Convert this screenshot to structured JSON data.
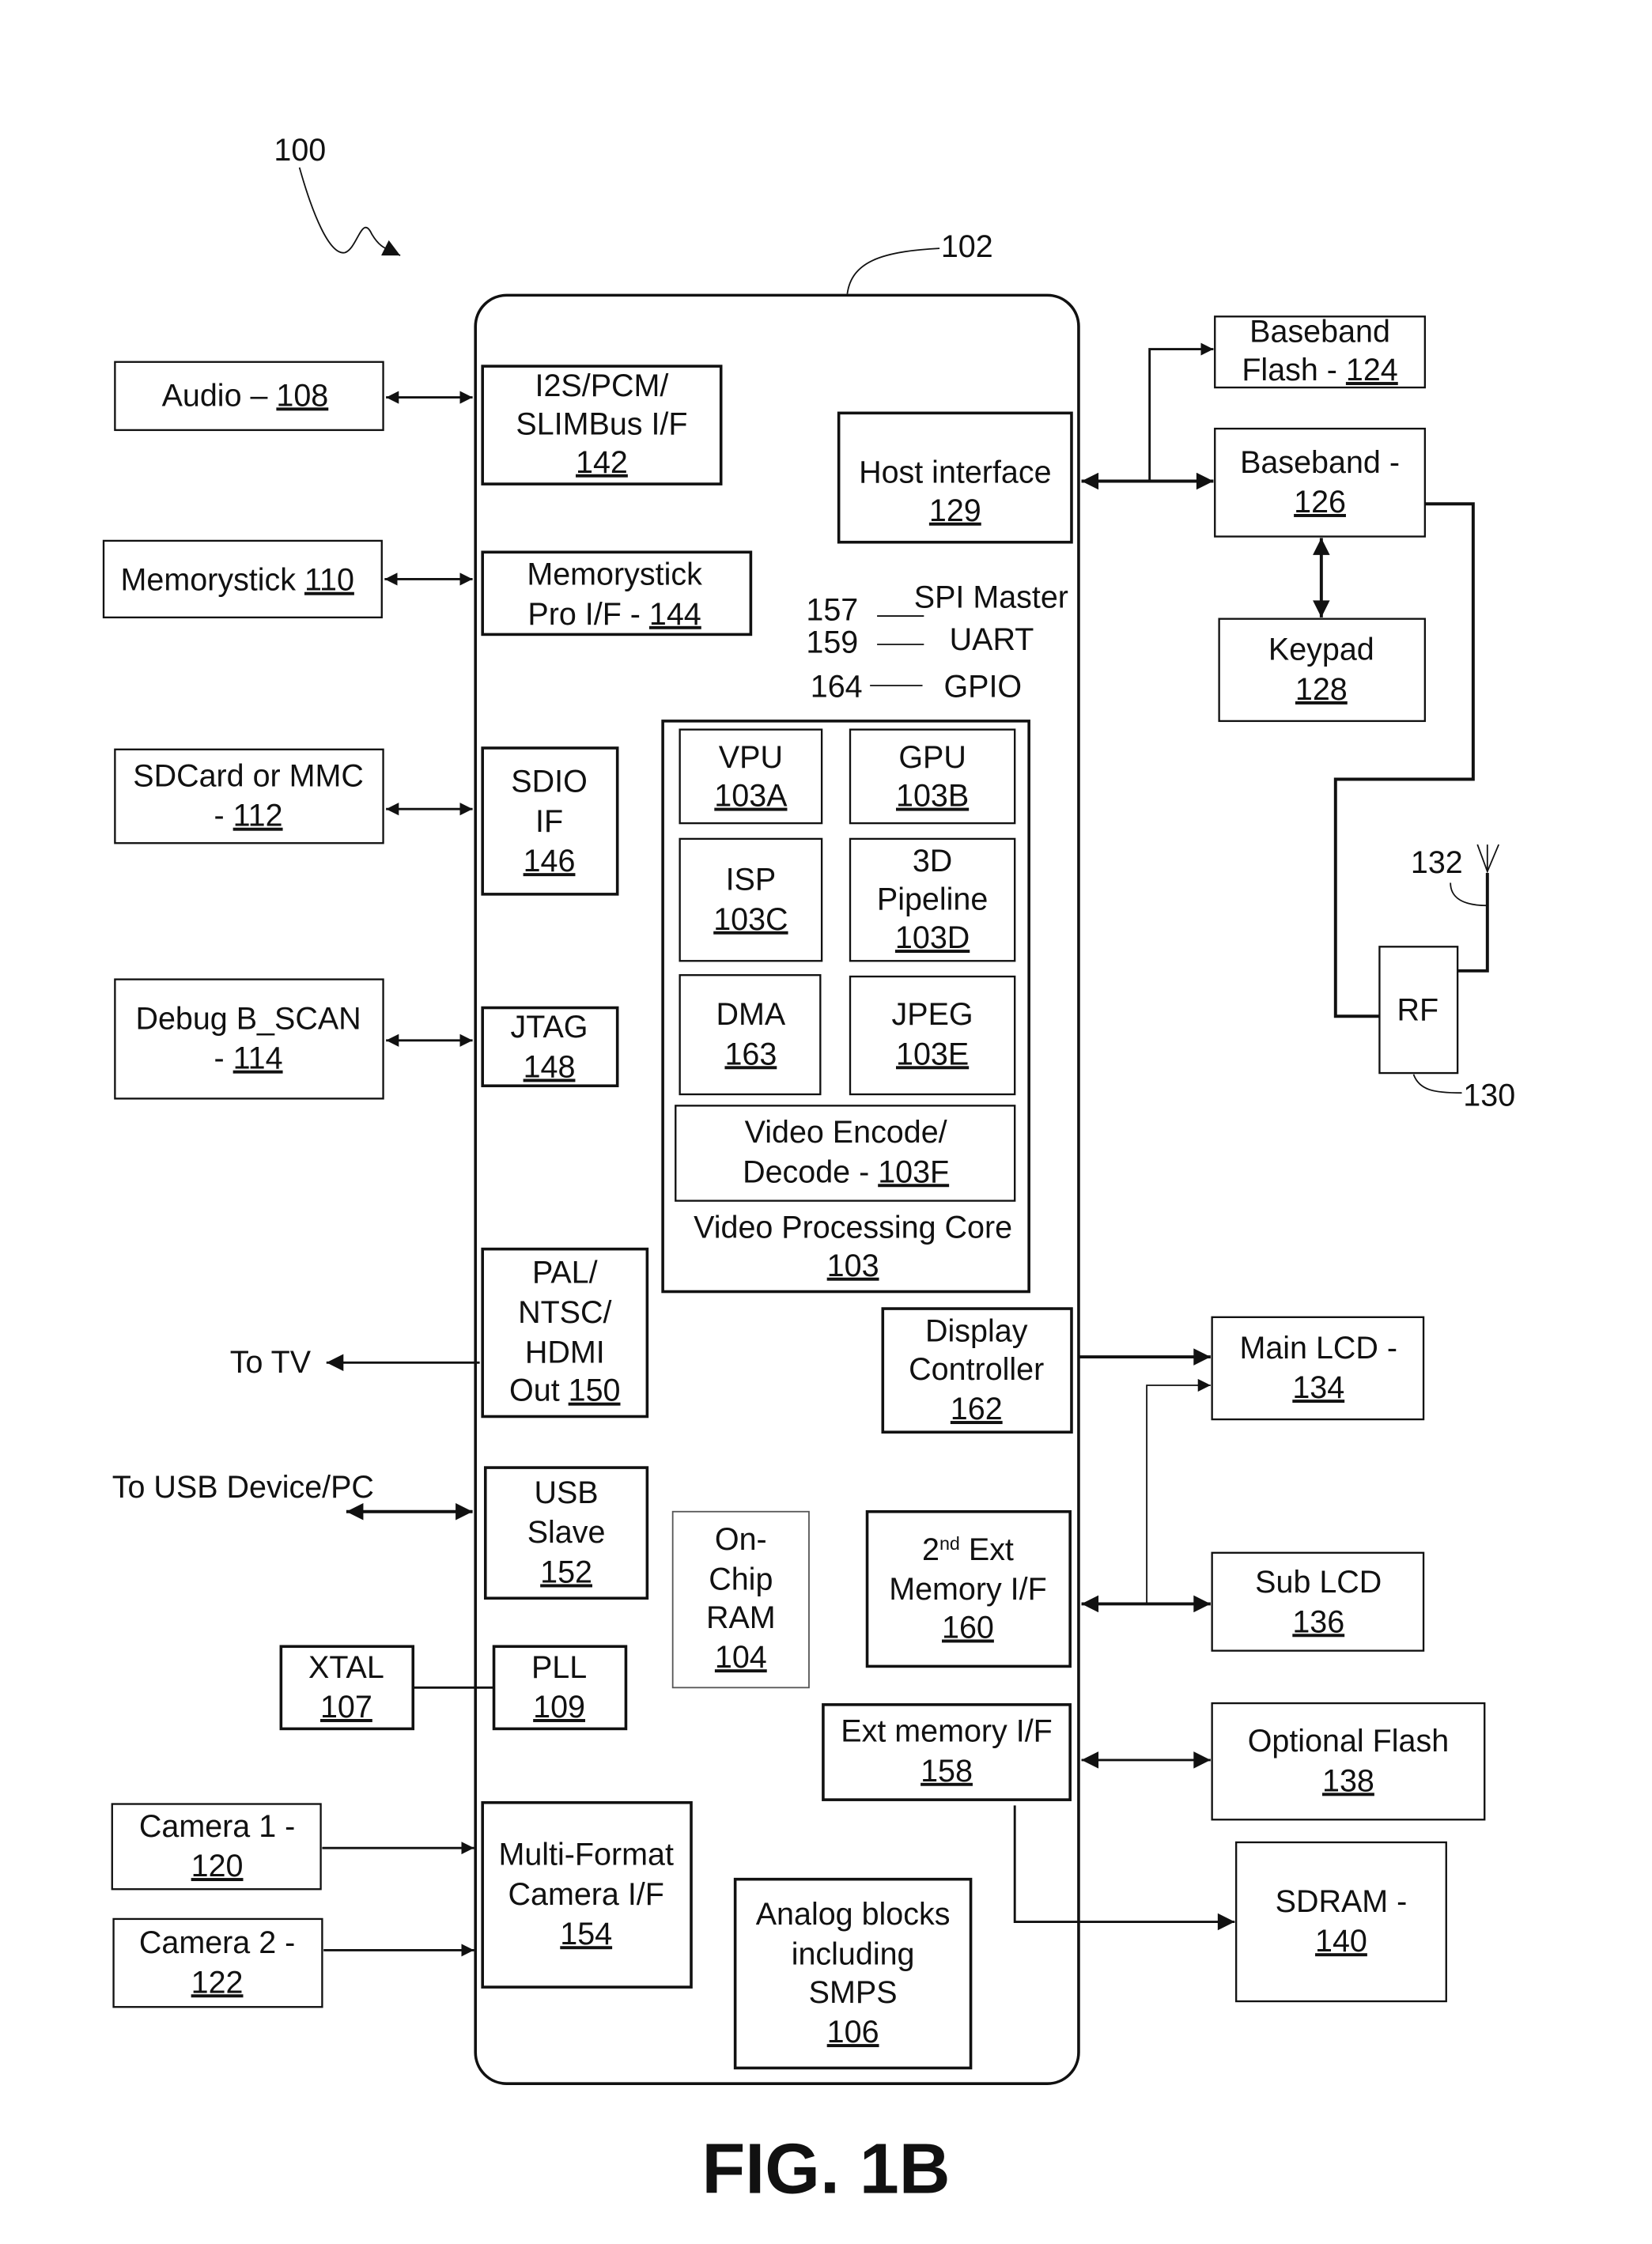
{
  "figure": {
    "caption": "FIG. 1B",
    "system_ref": "100",
    "chip_ref": "102"
  },
  "external_left": {
    "audio": {
      "label": "Audio – ",
      "ref": "108"
    },
    "memorystick": {
      "label": "Memorystick ",
      "ref": "110"
    },
    "sdcard": {
      "line1": "SDCard or MMC",
      "line2": "- ",
      "ref": "112"
    },
    "debug": {
      "line1": "Debug B_SCAN",
      "line2": "- ",
      "ref": "114"
    },
    "to_tv": "To TV",
    "to_usb": "To USB Device/PC",
    "xtal": {
      "label": "XTAL",
      "ref": "107"
    },
    "camera1": {
      "line1": "Camera 1 -",
      "ref": "120"
    },
    "camera2": {
      "line1": "Camera 2 -",
      "ref": "122"
    }
  },
  "chip_blocks": {
    "i2s": {
      "line1": "I2S/PCM/",
      "line2": "SLIMBus I/F",
      "ref": "142"
    },
    "mspro": {
      "line1": "Memorystick",
      "line2": "Pro I/F - ",
      "ref": "144"
    },
    "sdio": {
      "line1": "SDIO",
      "line2": "IF",
      "ref": "146"
    },
    "jtag": {
      "label": "JTAG",
      "ref": "148"
    },
    "tvout": {
      "line1": "PAL/",
      "line2": "NTSC/",
      "line3": "HDMI",
      "line4": "Out ",
      "ref": "150"
    },
    "usb": {
      "line1": "USB",
      "line2": "Slave",
      "ref": "152"
    },
    "pll": {
      "label": "PLL",
      "ref": "109"
    },
    "camif": {
      "line1": "Multi-Format",
      "line2": "Camera I/F",
      "ref": "154"
    },
    "host": {
      "label": "Host interface",
      "ref": "129"
    },
    "spi": {
      "ref": "157",
      "label": "SPI Master"
    },
    "uart": {
      "ref": "159",
      "label": "UART"
    },
    "gpio": {
      "ref": "164",
      "label": "GPIO"
    },
    "vpc": {
      "line1": "Video Processing Core",
      "ref": "103",
      "vpu": {
        "label": "VPU",
        "ref": "103A"
      },
      "gpu": {
        "label": "GPU",
        "ref": "103B"
      },
      "isp": {
        "label": "ISP",
        "ref": "103C"
      },
      "pipe": {
        "line1": "3D",
        "line2": "Pipeline",
        "ref": "103D"
      },
      "dma": {
        "label": "DMA",
        "ref": "163"
      },
      "jpeg": {
        "label": "JPEG",
        "ref": "103E"
      },
      "venc": {
        "line1": "Video Encode/",
        "line2": "Decode - ",
        "ref": "103F"
      }
    },
    "display": {
      "line1": "Display",
      "line2": "Controller",
      "ref": "162"
    },
    "ram": {
      "line1": "On-",
      "line2": "Chip",
      "line3": "RAM",
      "ref": "104"
    },
    "extmem2": {
      "pre": "2",
      "sup": "nd",
      "post": " Ext",
      "line2": "Memory I/F",
      "ref": "160"
    },
    "extmem": {
      "label": "Ext memory I/F",
      "ref": "158"
    },
    "analog": {
      "line1": "Analog blocks",
      "line2": "including",
      "line3": "SMPS",
      "ref": "106"
    }
  },
  "external_right": {
    "bbflash": {
      "line1": "Baseband",
      "line2": "Flash - ",
      "ref": "124"
    },
    "baseband": {
      "line1": "Baseband -",
      "ref": "126"
    },
    "keypad": {
      "label": "Keypad",
      "ref": "128"
    },
    "antenna_ref": "132",
    "rf": {
      "label": "RF",
      "ref": "130"
    },
    "mainlcd": {
      "line1": "Main LCD -",
      "ref": "134"
    },
    "sublcd": {
      "line1": "Sub LCD",
      "ref": "136"
    },
    "optflash": {
      "line1": "Optional Flash",
      "ref": "138"
    },
    "sdram": {
      "line1": "SDRAM -",
      "ref": "140"
    }
  }
}
